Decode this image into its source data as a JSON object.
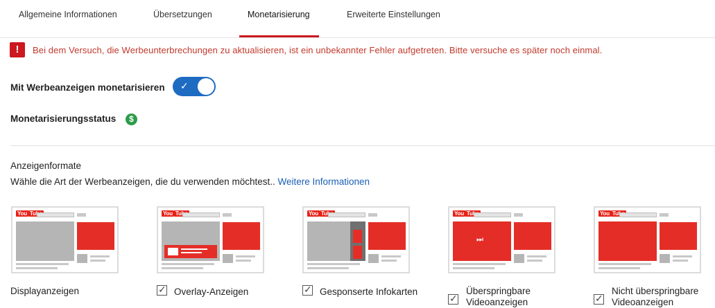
{
  "tabs": [
    {
      "label": "Allgemeine Informationen",
      "active": false
    },
    {
      "label": "Übersetzungen",
      "active": false
    },
    {
      "label": "Monetarisierung",
      "active": true
    },
    {
      "label": "Erweiterte Einstellungen",
      "active": false
    }
  ],
  "error": {
    "icon": "!",
    "message": "Bei dem Versuch, die Werbeunterbrechungen zu aktualisieren, ist ein unbekannter Fehler aufgetreten. Bitte versuche es später noch einmal."
  },
  "monetize": {
    "label": "Mit Werbeanzeigen monetarisieren",
    "toggle_on": true,
    "toggle_check": "✓"
  },
  "status": {
    "label": "Monetarisierungsstatus",
    "icon_glyph": "$"
  },
  "ad_formats": {
    "title": "Anzeigenformate",
    "description": "Wähle die Art der Werbeanzeigen, die du verwenden möchtest..",
    "link": "Weitere Informationen",
    "logo_you": "You",
    "logo_tube": "Tube",
    "skip_glyph": "⏭",
    "check_glyph": "✓",
    "items": [
      {
        "label": "Displayanzeigen",
        "has_checkbox": false,
        "checked": false
      },
      {
        "label": "Overlay-Anzeigen",
        "has_checkbox": true,
        "checked": true
      },
      {
        "label": "Gesponserte Infokarten",
        "has_checkbox": true,
        "checked": true
      },
      {
        "label": "Überspringbare Videoanzeigen",
        "has_checkbox": true,
        "checked": true
      },
      {
        "label": "Nicht überspringbare Videoanzeigen",
        "has_checkbox": true,
        "checked": true
      }
    ]
  },
  "colors": {
    "accent_red": "#cc181e",
    "toggle_blue": "#1e6bc2",
    "link_blue": "#1a5fb4",
    "status_green": "#2c9b4a"
  }
}
